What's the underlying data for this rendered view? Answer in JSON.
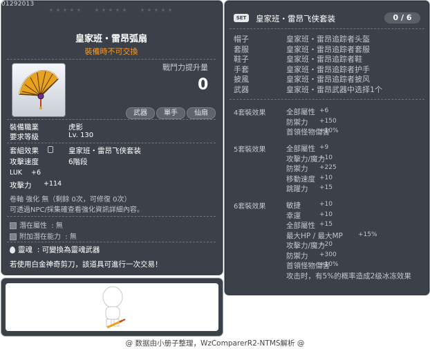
{
  "item": {
    "code": "01292013",
    "name": "皇家班・雷昂弧扇",
    "trade_note": "裝備時不可交換",
    "damage_label": "戰鬥力提升量",
    "damage_value": "0",
    "tags": [
      "武器",
      "單手",
      "仙扇"
    ],
    "stars_groups": 3,
    "job_label": "裝備職業",
    "job_value": "虎影",
    "level_label": "要求等級",
    "level_value": "Lv. 130",
    "set_label": "套組效果",
    "set_value": "皇家班・雷昂飞侠套装",
    "speed_label": "攻擊速度",
    "speed_value": "6階段",
    "luk_label": "LUK",
    "luk_value": "+6",
    "atk_label": "攻擊力",
    "atk_value": "+114",
    "scroll_text": "卷軸 強化 無（剩餘 0次，可修復 0次）",
    "upgrade_note": "可透過NPC/採集確查看強化資訊詳細內容。",
    "potential_label": "潛在屬性",
    "potential_value": ": 無",
    "add_potential_label": "附加潛在能力",
    "add_potential_value": ": 無",
    "soul_label": "靈魂",
    "soul_value": ": 可變換為靈魂武器",
    "scissors_note": "若使用白金神奇剪刀，該道具可進行一次交易！"
  },
  "set": {
    "badge": "SET",
    "title": "皇家班・雷昂飞侠套装",
    "count": "0 / 6",
    "parts": [
      {
        "slot": "帽子",
        "name": "皇家班・雷昂追踪者头盔"
      },
      {
        "slot": "套服",
        "name": "皇家班・雷昂追踪者套服"
      },
      {
        "slot": "鞋子",
        "name": "皇家班・雷昂追踪者鞋"
      },
      {
        "slot": "手套",
        "name": "皇家班・雷昂追踪者护手"
      },
      {
        "slot": "披風",
        "name": "皇家班・雷昂追踪者披风"
      },
      {
        "slot": "武器",
        "name": "皇家班・雷昂武器中选择1个"
      }
    ],
    "effects": [
      {
        "head": "4套裝效果",
        "lines": [
          {
            "k": "全部屬性",
            "v": "+6"
          },
          {
            "k": "防禦力",
            "v": "+150"
          },
          {
            "k": "首領怪物傷害",
            "v": "+10%"
          }
        ]
      },
      {
        "head": "5套裝效果",
        "lines": [
          {
            "k": "全部屬性",
            "v": "+9"
          },
          {
            "k": "攻擊力/魔力",
            "v": "+10"
          },
          {
            "k": "防禦力",
            "v": "+225"
          },
          {
            "k": "移動速度",
            "v": "+10"
          },
          {
            "k": "跳躍力",
            "v": "+15"
          }
        ]
      },
      {
        "head": "6套裝效果",
        "lines": [
          {
            "k": "敏捷",
            "v": "+10"
          },
          {
            "k": "幸運",
            "v": "+10"
          },
          {
            "k": "全部屬性",
            "v": "+15"
          },
          {
            "k": "最大HP / 最大MP",
            "v": "+15%"
          },
          {
            "k": "攻擊力/魔力",
            "v": "+20"
          },
          {
            "k": "防禦力",
            "v": "+300"
          },
          {
            "k": "首領怪物傷害",
            "v": "+10%"
          },
          {
            "k": "攻击时，有5%的概率造成2级冰冻效果",
            "v": ""
          }
        ]
      }
    ]
  },
  "footer": "@ 数据由小册子整理，WzComparerR2-NTMS解析 @",
  "colors": {
    "panel": "#3c4149",
    "accent_orange": "#ff9a1f",
    "text": "#ffffff",
    "dim": "#c2c7cd"
  }
}
